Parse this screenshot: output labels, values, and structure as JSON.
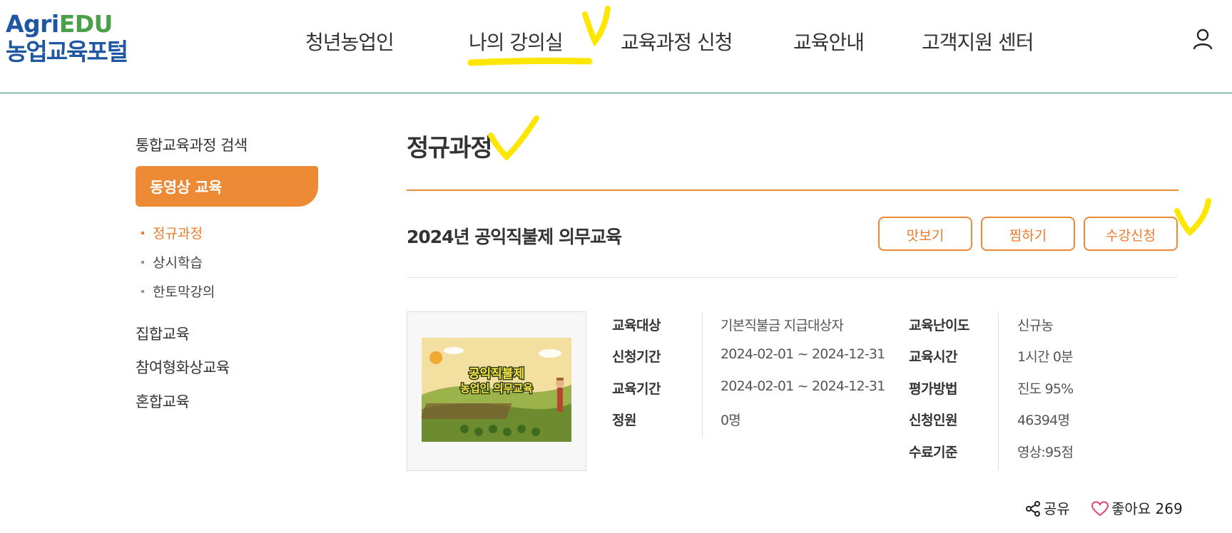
{
  "logo": {
    "line1_a": "Agri",
    "line1_b": "EDU",
    "line2": "농업교육포털"
  },
  "nav": [
    {
      "label": "청년농업인"
    },
    {
      "label": "나의 강의실"
    },
    {
      "label": "교육과정 신청"
    },
    {
      "label": "교육안내"
    },
    {
      "label": "고객지원 센터"
    }
  ],
  "sidebar": {
    "search": "통합교육과정 검색",
    "active": "동영상 교육",
    "sub_items": [
      "정규과정",
      "상시학습",
      "한토막강의"
    ],
    "groups": [
      "집합교육",
      "참여형화상교육",
      "혼합교육"
    ]
  },
  "main": {
    "page_title": "정규과정",
    "course_title": "2024년 공익직불제 의무교육",
    "buttons": {
      "preview": "맛보기",
      "wishlist": "찜하기",
      "enroll": "수강신청"
    },
    "thumbnail": {
      "line1": "공익직불제",
      "line2": "농업인 의무교육"
    },
    "info_left": [
      {
        "label": "교육대상",
        "value": "기본직불금 지급대상자"
      },
      {
        "label": "신청기간",
        "value": "2024-02-01 ~ 2024-12-31"
      },
      {
        "label": "교육기간",
        "value": "2024-02-01 ~ 2024-12-31"
      },
      {
        "label": "정원",
        "value": "0명"
      }
    ],
    "info_right": [
      {
        "label": "교육난이도",
        "value": "신규농"
      },
      {
        "label": "교육시간",
        "value": "1시간 0분"
      },
      {
        "label": "평가방법",
        "value": "진도 95%"
      },
      {
        "label": "신청인원",
        "value": "46394명"
      },
      {
        "label": "수료기준",
        "value": "영상:95점"
      }
    ],
    "share_label": "공유",
    "like_label": "좋아요 269"
  },
  "colors": {
    "accent": "#ec8a35",
    "brand_blue": "#1f57a2",
    "brand_green": "#4aa14a",
    "highlight": "#ffe600"
  }
}
